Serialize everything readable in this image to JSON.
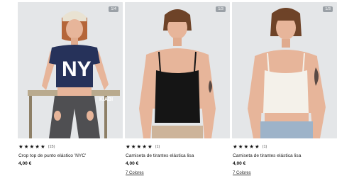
{
  "products": [
    {
      "image_counter": "1/4",
      "stars": [
        "★",
        "★",
        "★",
        "★",
        "★"
      ],
      "rating_count": "(15)",
      "name": "Crop top de punto elástico 'NYC'",
      "price": "4,00 €",
      "colors_link": "",
      "graphic_text": "NY",
      "brand_sign": "KIABI"
    },
    {
      "image_counter": "1/3",
      "stars": [
        "★",
        "★",
        "★",
        "★",
        "★"
      ],
      "rating_count": "(1)",
      "name": "Camiseta de tirantes elástica lisa",
      "price": "4,00 €",
      "colors_link": "7 Colores"
    },
    {
      "image_counter": "1/3",
      "stars": [
        "★",
        "★",
        "★",
        "★",
        "★"
      ],
      "rating_count": "(1)",
      "name": "Camiseta de tirantes elástica lisa",
      "price": "4,00 €",
      "colors_link": "7 Colores"
    }
  ],
  "colors": {
    "background": "#e4e6e8",
    "navy_top": "#26325a",
    "black_top": "#151515",
    "white_top": "#f4f1ea",
    "skin": "#e7b59a",
    "hair_red": "#b5663a",
    "hair_brown": "#6e4328"
  }
}
